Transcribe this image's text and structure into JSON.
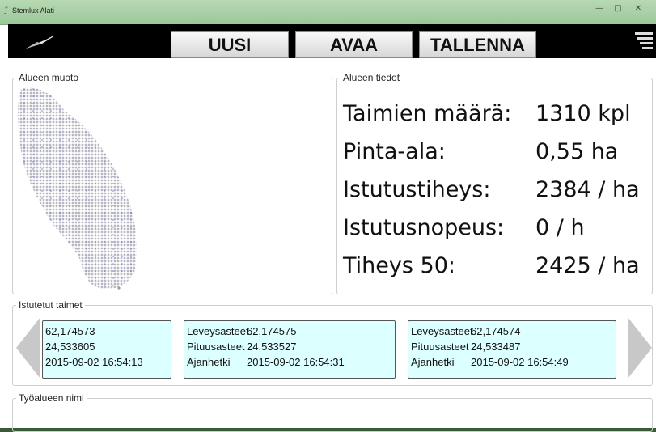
{
  "window": {
    "title": "Stemlux Alati",
    "controls": {
      "minimize": "—",
      "maximize": "□",
      "close": "✕"
    }
  },
  "toolbar": {
    "uusi_label": "UUSI",
    "avaa_label": "AVAA",
    "tallenna_label": "TALLENNA"
  },
  "shape_group": {
    "label": "Alueen muoto"
  },
  "info_group": {
    "label": "Alueen tiedot",
    "rows": [
      {
        "key": "Taimien määrä:",
        "value": "1310 kpl"
      },
      {
        "key": "Pinta-ala:",
        "value": "0,55 ha"
      },
      {
        "key": "Istutustiheys:",
        "value": "2384 / ha"
      },
      {
        "key": "Istutusnopeus:",
        "value": "0 / h"
      },
      {
        "key": "Tiheys 50:",
        "value": "2425 / ha"
      }
    ]
  },
  "planted_group": {
    "label": "Istutetut taimet",
    "cards": [
      {
        "lat_label": "",
        "lat": "62,174573",
        "lon_label": "",
        "lon": "24,533605",
        "time_label": "",
        "time": "2015-09-02 16:54:13"
      },
      {
        "lat_label": "Leveysasteet",
        "lat": "62,174575",
        "lon_label": "Pituusasteet",
        "lon": "24,533527",
        "time_label": "Ajanhetki",
        "time": "2015-09-02 16:54:31"
      },
      {
        "lat_label": "Leveysasteet",
        "lat": "62,174574",
        "lon_label": "Pituusasteet",
        "lon": "24,533487",
        "time_label": "Ajanhetki",
        "time": "2015-09-02 16:54:49"
      }
    ]
  },
  "area_group": {
    "label": "Työalueen nimi"
  },
  "colors": {
    "card_bg": "#dcffff",
    "toolbar_bg": "#000000",
    "titlebar": "#a9d1a6"
  }
}
